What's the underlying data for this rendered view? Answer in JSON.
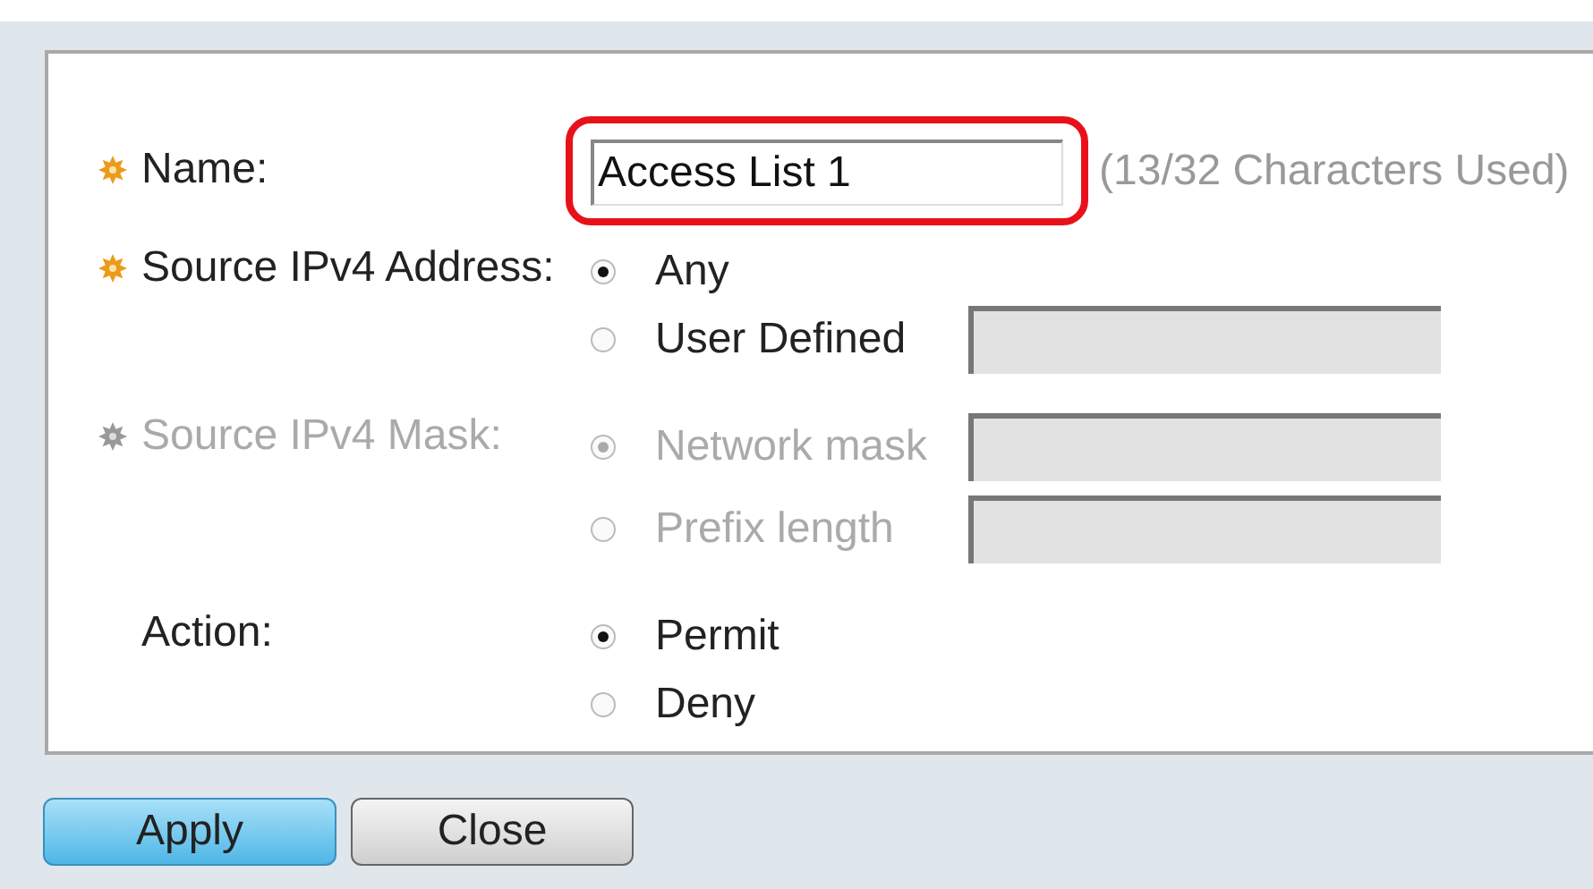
{
  "form": {
    "fields": [
      {
        "kind": "text",
        "label": "Name:",
        "required": true,
        "disabled": false,
        "value": "Access List 1",
        "highlighted": true,
        "hint": "(13/32 Characters Used)"
      },
      {
        "kind": "radio",
        "label": "Source IPv4 Address:",
        "required": true,
        "disabled": false,
        "options": [
          {
            "label": "Any",
            "selected": true,
            "input": false
          },
          {
            "label": "User Defined",
            "selected": false,
            "input": true
          }
        ]
      },
      {
        "kind": "radio",
        "label": "Source IPv4 Mask:",
        "required": true,
        "disabled": true,
        "options": [
          {
            "label": "Network mask",
            "selected": true,
            "input": true
          },
          {
            "label": "Prefix length",
            "selected": false,
            "input": true
          }
        ]
      },
      {
        "kind": "radio",
        "label": "Action:",
        "required": false,
        "disabled": false,
        "options": [
          {
            "label": "Permit",
            "selected": true,
            "input": false
          },
          {
            "label": "Deny",
            "selected": false,
            "input": false
          }
        ]
      }
    ]
  },
  "buttons": [
    {
      "label": "Apply",
      "kind": "primary"
    },
    {
      "label": "Close",
      "kind": "secondary"
    }
  ]
}
